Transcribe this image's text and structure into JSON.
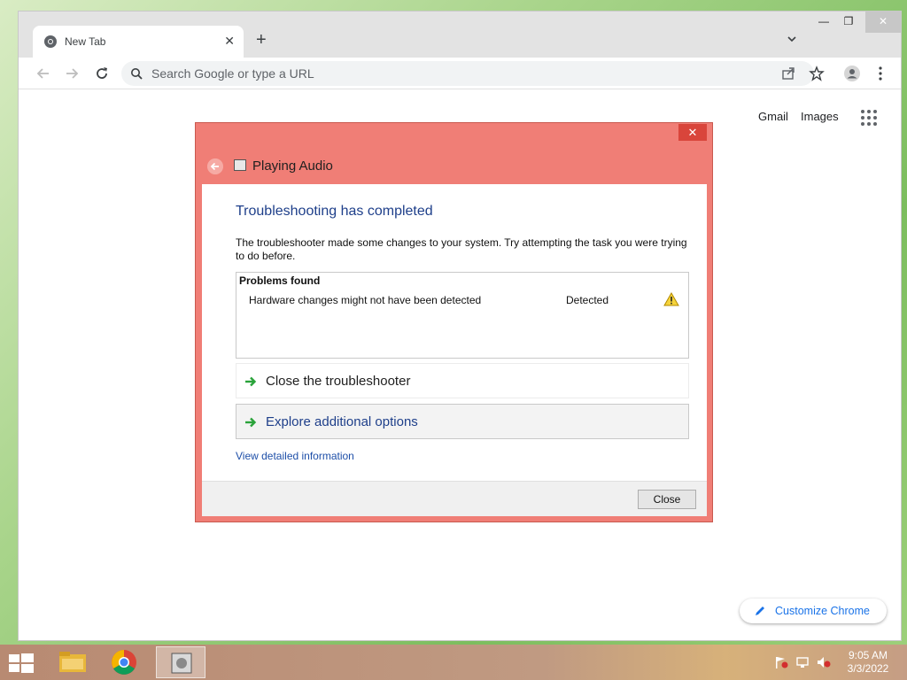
{
  "browser": {
    "tab_title": "New Tab",
    "omnibox_placeholder": "Search Google or type a URL",
    "ntp_links": {
      "gmail": "Gmail",
      "images": "Images"
    },
    "customize_label": "Customize Chrome"
  },
  "dialog": {
    "title": "Playing Audio",
    "heading": "Troubleshooting has completed",
    "description": "The troubleshooter made some changes to your system. Try attempting the task you were trying to do before.",
    "problems_header": "Problems found",
    "problems": [
      {
        "name": "Hardware changes might not have been detected",
        "status": "Detected",
        "icon": "warning-icon"
      }
    ],
    "options": [
      {
        "label": "Close the troubleshooter",
        "icon": "green-arrow-icon"
      },
      {
        "label": "Explore additional options",
        "icon": "green-arrow-icon"
      }
    ],
    "detail_link": "View detailed information",
    "close_button": "Close"
  },
  "taskbar": {
    "time": "9:05 AM",
    "date": "3/3/2022",
    "apps": [
      "file-explorer",
      "chrome",
      "troubleshooter"
    ]
  },
  "colors": {
    "dialog_frame": "#f07e76",
    "heading_blue": "#1e3f8a",
    "link_blue": "#1a73e8"
  }
}
